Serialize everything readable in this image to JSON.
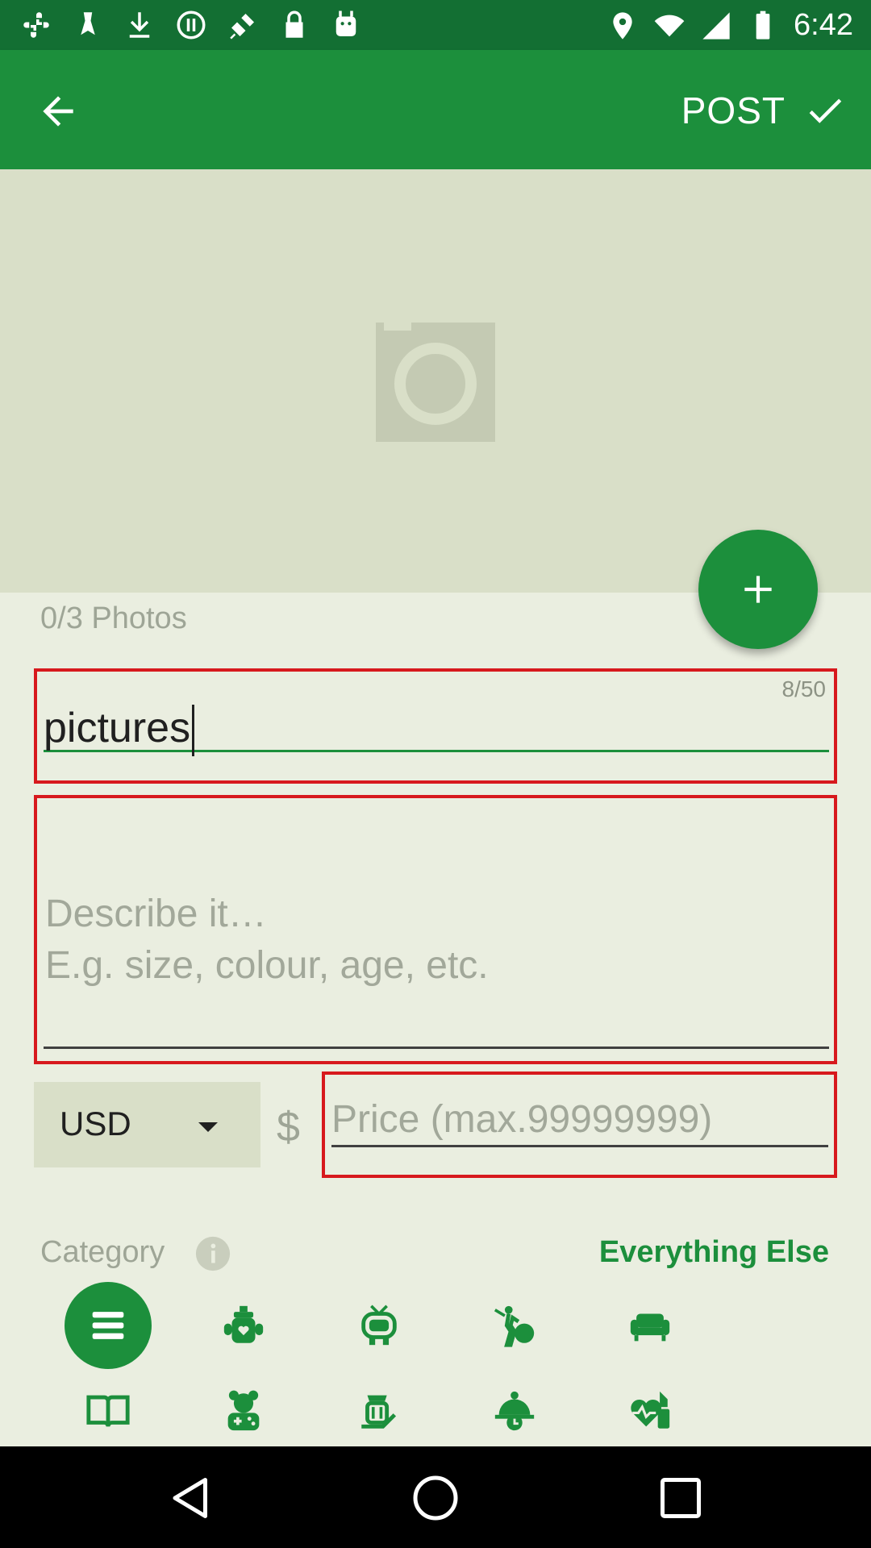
{
  "status_bar": {
    "time": "6:42",
    "left_icons": [
      "slack-icon",
      "ribbon-icon",
      "download-icon",
      "circle-pause-icon",
      "fake-gps-icon",
      "lock-icon",
      "android-icon"
    ],
    "right_icons": [
      "location-icon",
      "wifi-icon",
      "signal-icon",
      "battery-icon"
    ]
  },
  "app_bar": {
    "post_label": "POST"
  },
  "photos": {
    "count_label": "0/3 Photos"
  },
  "title_field": {
    "counter": "8/50",
    "value": "pictures"
  },
  "description_field": {
    "placeholder_line1": "Describe it…",
    "placeholder_line2": "E.g. size, colour, age, etc."
  },
  "price": {
    "currency": "USD",
    "symbol": "$",
    "placeholder": "Price (max.99999999)"
  },
  "category": {
    "label": "Category",
    "selected": "Everything Else",
    "icons_row1": [
      "list-icon",
      "baby-bottle-icon",
      "tv-icon",
      "sports-icon",
      "sofa-icon"
    ],
    "icons_row2": [
      "book-icon",
      "toys-icon",
      "tools-icon",
      "kitchen-timer-icon",
      "health-beauty-icon"
    ]
  },
  "colors": {
    "primary": "#1c8f3c",
    "status_bar": "#136f33",
    "error_border": "#d7191d",
    "background": "#eaeee0"
  }
}
